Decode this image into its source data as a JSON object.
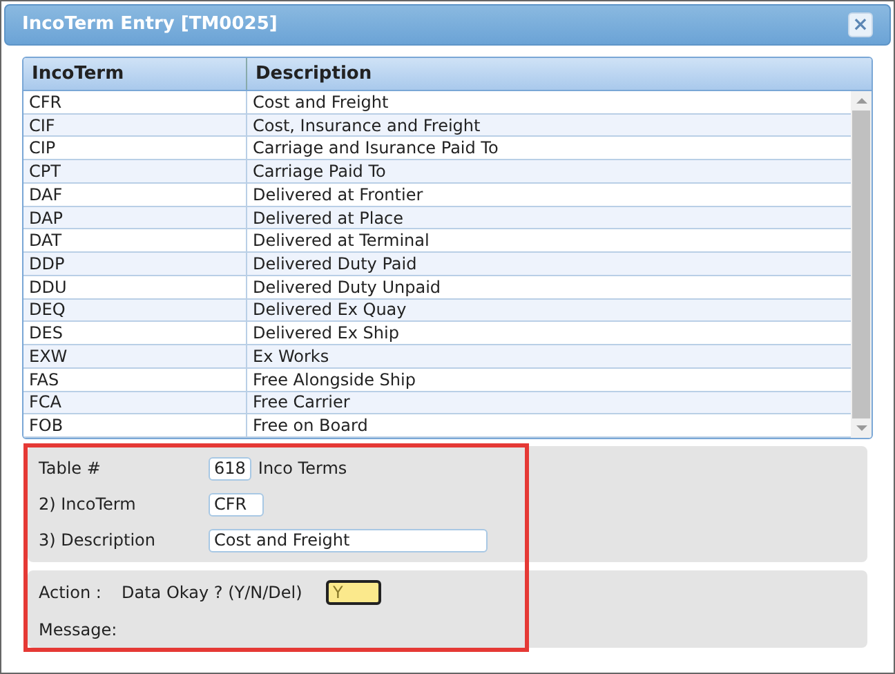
{
  "window": {
    "title": "IncoTerm Entry [TM0025]",
    "close": "×"
  },
  "table": {
    "columns": [
      "IncoTerm",
      "Description"
    ],
    "rows": [
      [
        "CFR",
        "Cost and Freight"
      ],
      [
        "CIF",
        "Cost, Insurance and Freight"
      ],
      [
        "CIP",
        "Carriage and Isurance Paid To"
      ],
      [
        "CPT",
        "Carriage Paid To"
      ],
      [
        "DAF",
        "Delivered at Frontier"
      ],
      [
        "DAP",
        "Delivered at Place"
      ],
      [
        "DAT",
        "Delivered at Terminal"
      ],
      [
        "DDP",
        "Delivered Duty Paid"
      ],
      [
        "DDU",
        "Delivered Duty Unpaid"
      ],
      [
        "DEQ",
        "Delivered Ex Quay"
      ],
      [
        "DES",
        "Delivered Ex Ship"
      ],
      [
        "EXW",
        "Ex Works"
      ],
      [
        "FAS",
        "Free Alongside Ship"
      ],
      [
        "FCA",
        "Free Carrier"
      ],
      [
        "FOB",
        "Free on Board"
      ]
    ]
  },
  "form": {
    "table_label": "Table #",
    "table_value": "618",
    "table_name": "Inco Terms",
    "incoterm_label": "2) IncoTerm",
    "incoterm_value": "CFR",
    "description_label": "3) Description",
    "description_value": "Cost and Freight"
  },
  "action": {
    "label": "Action :",
    "prompt": "Data Okay ? (Y/N/Del)",
    "value": "Y",
    "message_label": "Message:"
  }
}
